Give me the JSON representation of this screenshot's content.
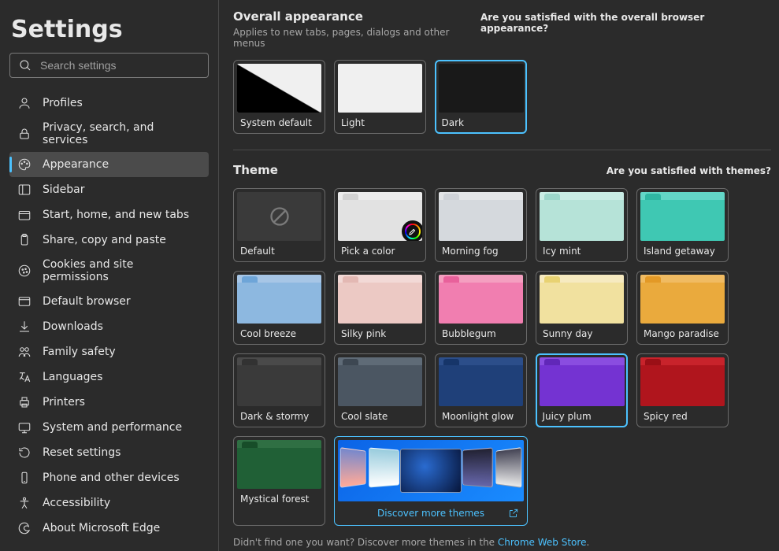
{
  "header": {
    "title": "Settings"
  },
  "search": {
    "placeholder": "Search settings"
  },
  "nav": {
    "items": [
      {
        "label": "Profiles"
      },
      {
        "label": "Privacy, search, and services"
      },
      {
        "label": "Appearance"
      },
      {
        "label": "Sidebar"
      },
      {
        "label": "Start, home, and new tabs"
      },
      {
        "label": "Share, copy and paste"
      },
      {
        "label": "Cookies and site permissions"
      },
      {
        "label": "Default browser"
      },
      {
        "label": "Downloads"
      },
      {
        "label": "Family safety"
      },
      {
        "label": "Languages"
      },
      {
        "label": "Printers"
      },
      {
        "label": "System and performance"
      },
      {
        "label": "Reset settings"
      },
      {
        "label": "Phone and other devices"
      },
      {
        "label": "Accessibility"
      },
      {
        "label": "About Microsoft Edge"
      }
    ]
  },
  "appearance": {
    "title": "Overall appearance",
    "subtitle": "Applies to new tabs, pages, dialogs and other menus",
    "feedback": "Are you satisfied with the overall browser appearance?",
    "options": [
      {
        "label": "System default"
      },
      {
        "label": "Light"
      },
      {
        "label": "Dark"
      }
    ]
  },
  "theme": {
    "title": "Theme",
    "feedback": "Are you satisfied with themes?",
    "items": [
      {
        "label": "Default"
      },
      {
        "label": "Pick a color"
      },
      {
        "label": "Morning fog"
      },
      {
        "label": "Icy mint"
      },
      {
        "label": "Island getaway"
      },
      {
        "label": "Cool breeze"
      },
      {
        "label": "Silky pink"
      },
      {
        "label": "Bubblegum"
      },
      {
        "label": "Sunny day"
      },
      {
        "label": "Mango paradise"
      },
      {
        "label": "Dark & stormy"
      },
      {
        "label": "Cool slate"
      },
      {
        "label": "Moonlight glow"
      },
      {
        "label": "Juicy plum"
      },
      {
        "label": "Spicy red"
      },
      {
        "label": "Mystical forest"
      }
    ],
    "discover": "Discover more themes",
    "footer_prefix": "Didn't find one you want? Discover more themes in the ",
    "footer_link": "Chrome Web Store",
    "footer_suffix": "."
  },
  "colors": {
    "themes": {
      "morning_fog": {
        "tabbar": "#e3e5e7",
        "tab": "#cfd3d8",
        "body": "#d5d9dd"
      },
      "icy_mint": {
        "tabbar": "#c9ece4",
        "tab": "#9cd6ca",
        "body": "#b6e3d8"
      },
      "island_getaway": {
        "tabbar": "#63d6c7",
        "tab": "#2fb7a3",
        "body": "#3fc8b3"
      },
      "cool_breeze": {
        "tabbar": "#a7c6e6",
        "tab": "#6ea5d8",
        "body": "#8db8e0"
      },
      "silky_pink": {
        "tabbar": "#f2d9d6",
        "tab": "#e3b8b3",
        "body": "#ecc9c4"
      },
      "bubblegum": {
        "tabbar": "#f49fc0",
        "tab": "#e8619b",
        "body": "#f17eb0"
      },
      "sunny_day": {
        "tabbar": "#f6eac0",
        "tab": "#e8d272",
        "body": "#f1e19f"
      },
      "mango_paradise": {
        "tabbar": "#f0bb62",
        "tab": "#e39926",
        "body": "#eaaa3d"
      },
      "dark_stormy": {
        "tabbar": "#4a4a4a",
        "tab": "#323232",
        "body": "#3a3a3a"
      },
      "cool_slate": {
        "tabbar": "#5f6b77",
        "tab": "#3d4752",
        "body": "#4b5662"
      },
      "moonlight_glow": {
        "tabbar": "#2c4e8a",
        "tab": "#163569",
        "body": "#1f4079"
      },
      "juicy_plum": {
        "tabbar": "#8a4de0",
        "tab": "#6127b8",
        "body": "#7433d2"
      },
      "spicy_red": {
        "tabbar": "#c8232b",
        "tab": "#9a0f16",
        "body": "#b0151d"
      },
      "mystical_forest": {
        "tabbar": "#2f6f43",
        "tab": "#174d29",
        "body": "#206036"
      },
      "pick": {
        "tabbar": "#ececec",
        "tab": "#d2d2d2",
        "body": "#e2e2e2"
      }
    }
  }
}
